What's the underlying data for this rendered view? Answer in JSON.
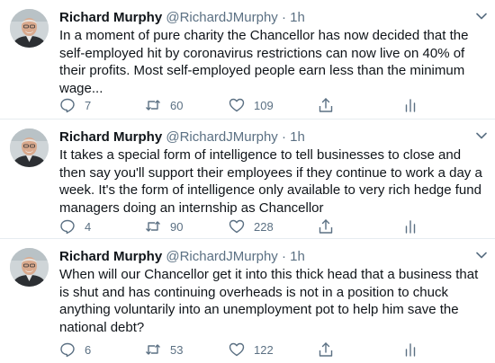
{
  "tweets": [
    {
      "name": "Richard Murphy",
      "handle": "@RichardJMurphy",
      "dot": "·",
      "time": "1h",
      "text": "In a moment of pure charity the Chancellor has now decided that the self-employed hit by coronavirus restrictions can now live on 40% of their profits. Most self-employed people earn less than the minimum wage...",
      "replies": "7",
      "retweets": "60",
      "likes": "109"
    },
    {
      "name": "Richard Murphy",
      "handle": "@RichardJMurphy",
      "dot": "·",
      "time": "1h",
      "text": "It takes a special form of intelligence to tell businesses to close and then say you'll support their employees if they continue to work a day a week. It's the form of intelligence only available to very rich hedge fund managers doing an internship as Chancellor",
      "replies": "4",
      "retweets": "90",
      "likes": "228"
    },
    {
      "name": "Richard Murphy",
      "handle": "@RichardJMurphy",
      "dot": "·",
      "time": "1h",
      "text": "When will our Chancellor get it into this thick head that a business that is shut and has continuing overheads is not in a position to chuck anything voluntarily into an unemployment pot to help him save the national debt?",
      "replies": "6",
      "retweets": "53",
      "likes": "122"
    }
  ],
  "icons": {
    "reply": "reply-icon",
    "retweet": "retweet-icon",
    "like": "heart-icon",
    "share": "share-icon",
    "analytics": "analytics-icon",
    "more": "chevron-down-icon"
  },
  "colors": {
    "text": "#0f1419",
    "muted": "#5b7083",
    "divider": "#e6ecf0"
  }
}
